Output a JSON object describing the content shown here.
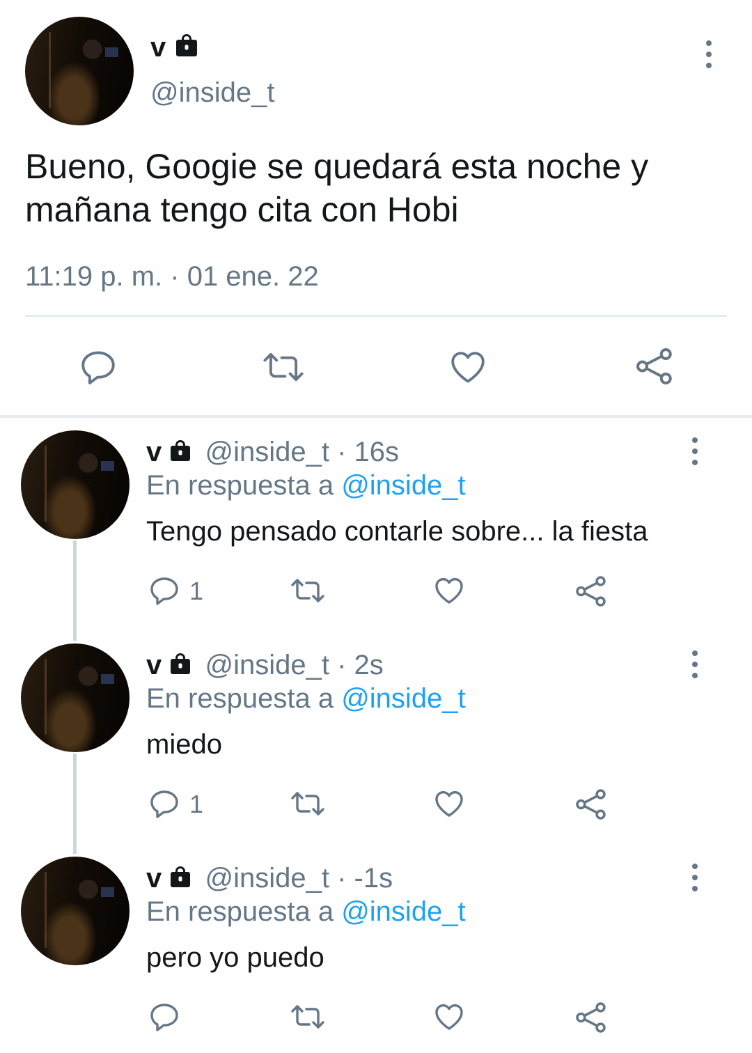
{
  "main_tweet": {
    "display_name": "v",
    "handle": "@inside_t",
    "text_line1": "Bueno, Googie se quedará esta noche y",
    "text_line2": "mañana tengo cita con Hobi",
    "timestamp": "11:19 p. m. · 01 ene. 22"
  },
  "replies": [
    {
      "display_name": "v",
      "handle": "@inside_t",
      "time": "· 16s",
      "reply_prefix": "En respuesta a ",
      "reply_to": "@inside_t",
      "text": "Tengo pensado contarle sobre... la fiesta",
      "reply_count": "1"
    },
    {
      "display_name": "v",
      "handle": "@inside_t",
      "time": "· 2s",
      "reply_prefix": "En respuesta a ",
      "reply_to": "@inside_t",
      "text": "miedo",
      "reply_count": "1"
    },
    {
      "display_name": "v",
      "handle": "@inside_t",
      "time": "· -1s",
      "reply_prefix": "En respuesta a ",
      "reply_to": "@inside_t",
      "text": "pero yo puedo",
      "reply_count": ""
    }
  ],
  "icons": {
    "reply": "speech-bubble-icon",
    "retweet": "retweet-icon",
    "like": "heart-icon",
    "share": "share-icon",
    "more": "more-vertical-icon",
    "lock": "lock-icon"
  },
  "colors": {
    "text": "#14171a",
    "secondary": "#657786",
    "link": "#1da1f2",
    "divider": "#e6ecf0",
    "thread_line": "#ccd6dd"
  }
}
